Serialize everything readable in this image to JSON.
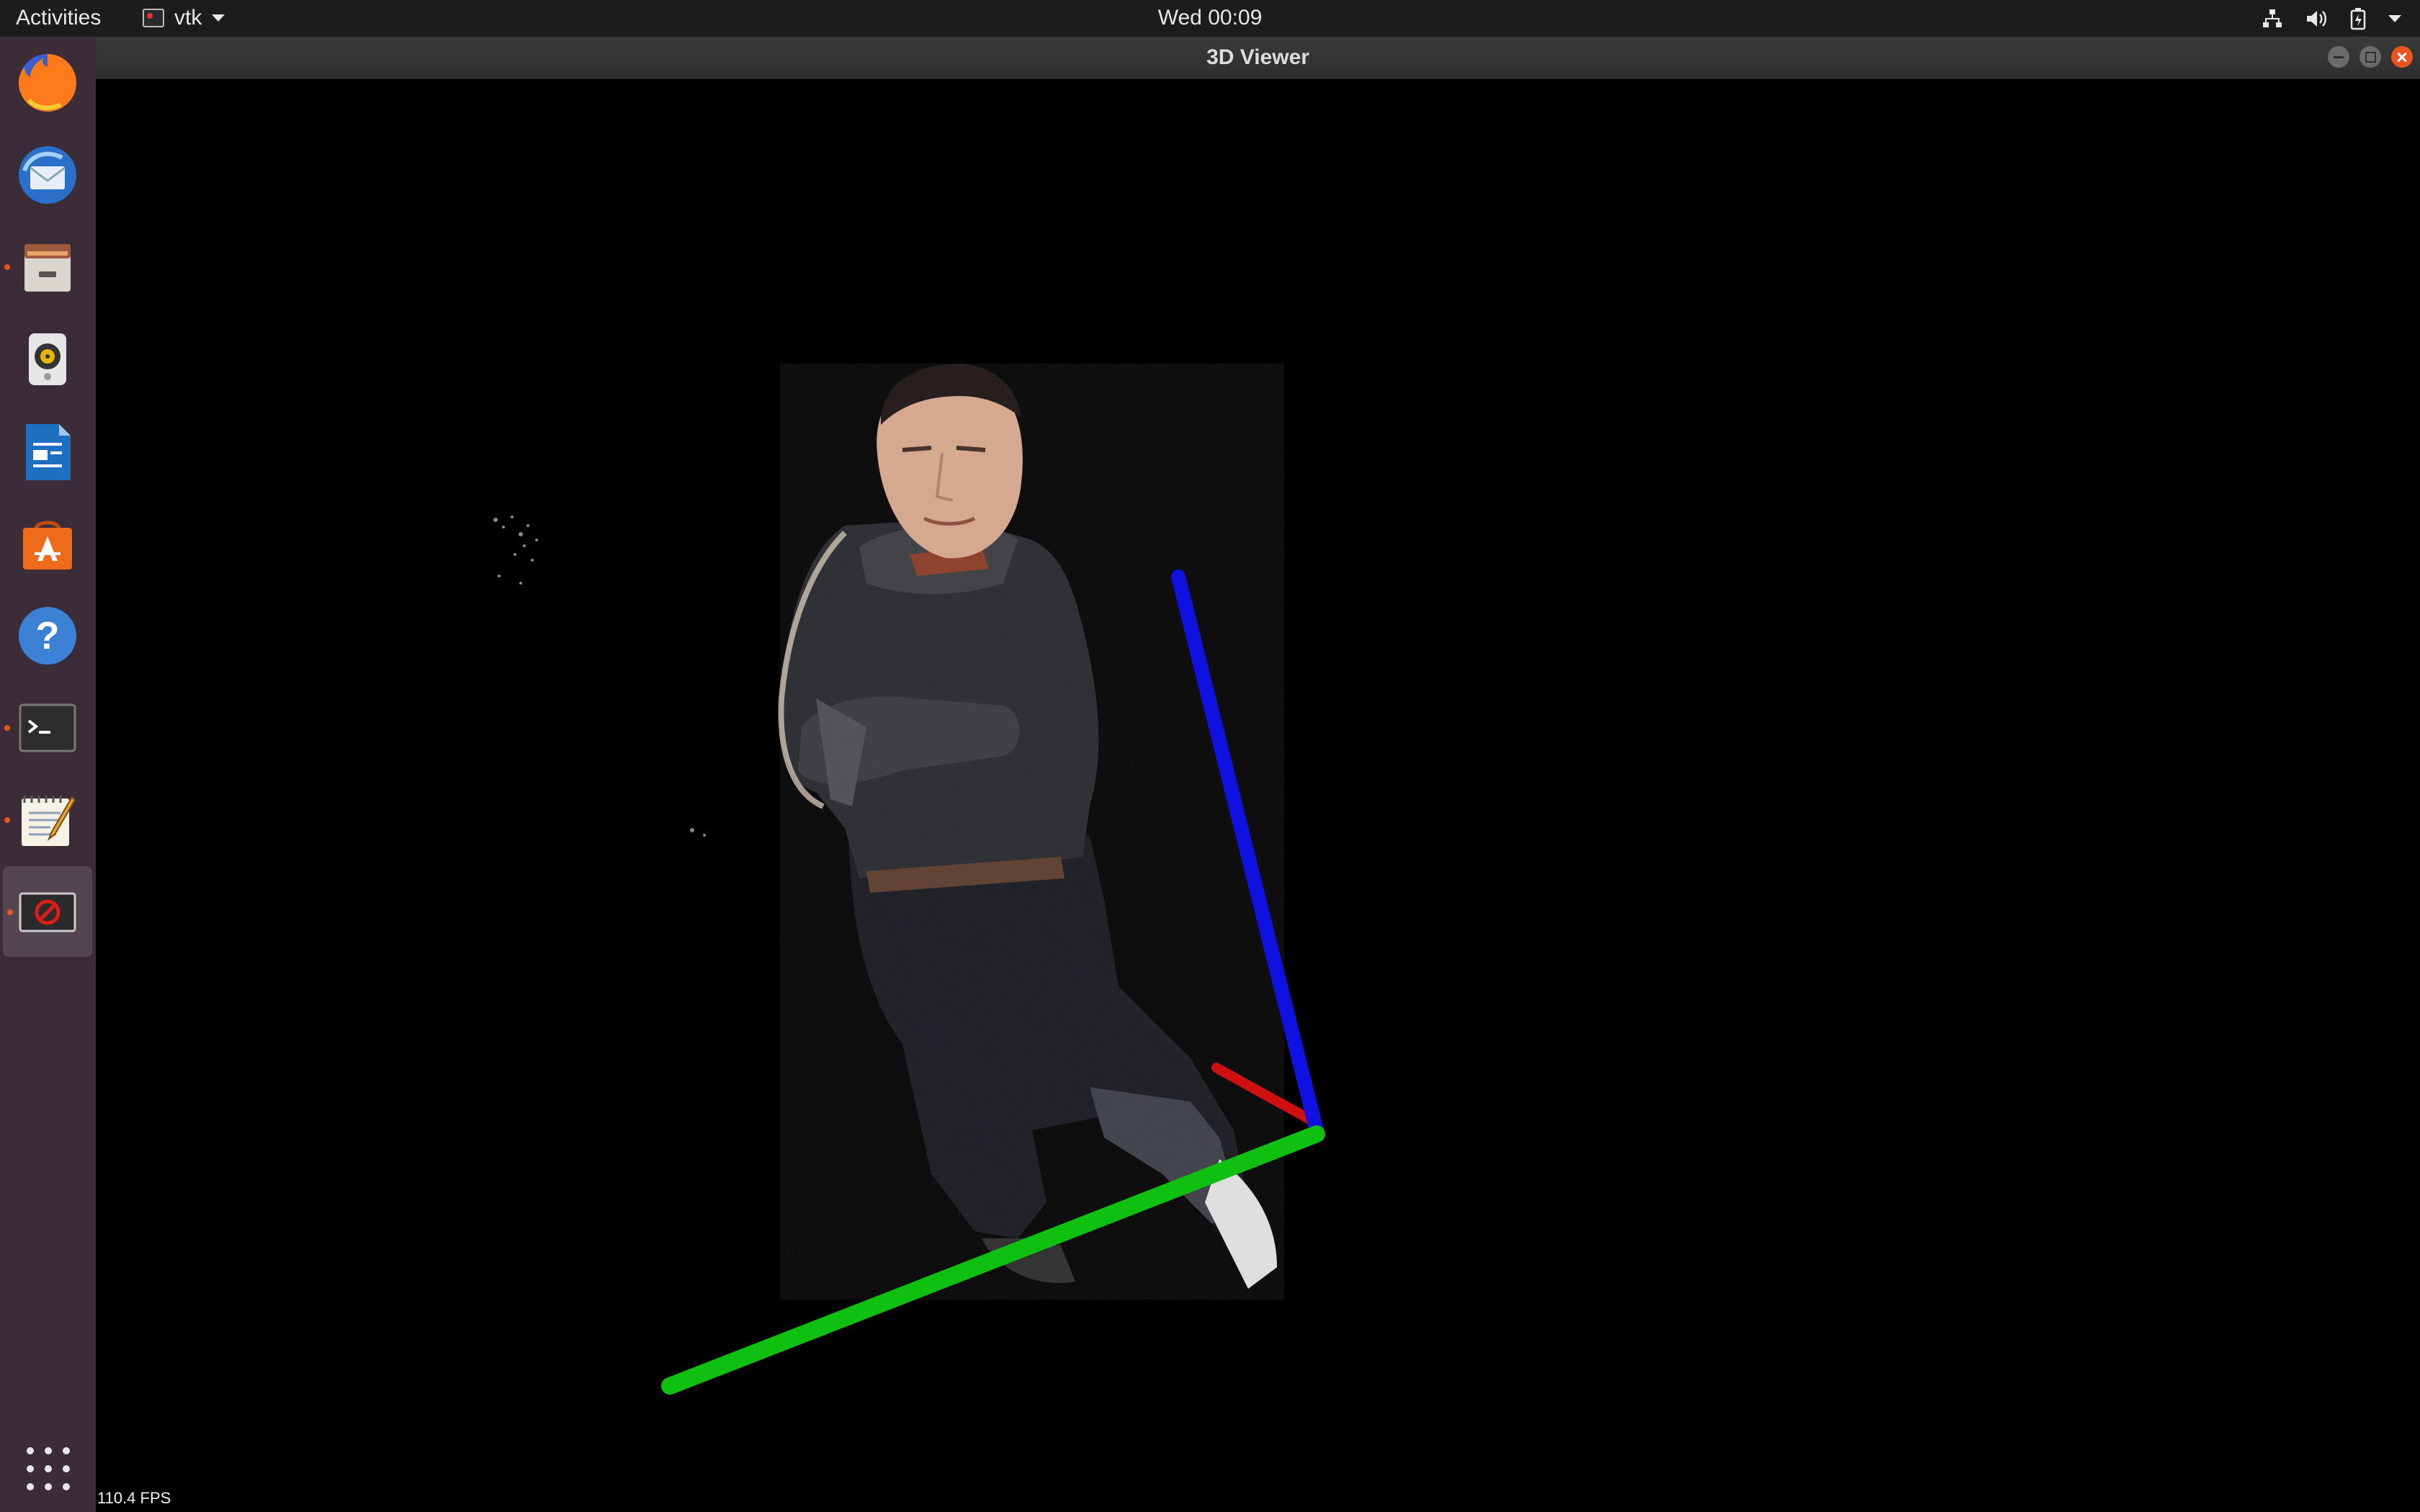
{
  "topbar": {
    "activities": "Activities",
    "app_name": "vtk",
    "clock": "Wed 00:09",
    "system_icons": [
      "network-icon",
      "volume-icon",
      "battery-icon",
      "system-menu-caret-icon"
    ]
  },
  "dock": {
    "items": [
      {
        "name": "Firefox",
        "icon": "firefox-icon",
        "running": false
      },
      {
        "name": "Thunderbird",
        "icon": "thunderbird-icon",
        "running": false
      },
      {
        "name": "Files",
        "icon": "files-icon",
        "running": true
      },
      {
        "name": "Rhythmbox",
        "icon": "rhythmbox-icon",
        "running": false
      },
      {
        "name": "LibreOffice Writer",
        "icon": "writer-icon",
        "running": false
      },
      {
        "name": "Ubuntu Software",
        "icon": "software-icon",
        "running": false
      },
      {
        "name": "Help",
        "icon": "help-icon",
        "running": false
      },
      {
        "name": "Terminal",
        "icon": "terminal-icon",
        "running": true
      },
      {
        "name": "Text Editor",
        "icon": "text-editor-icon",
        "running": true
      },
      {
        "name": "vtk",
        "icon": "vtk-app-icon",
        "running": true,
        "active": true
      }
    ],
    "show_apps_icon": "grid-icon"
  },
  "window": {
    "title": "3D Viewer",
    "buttons": [
      "minimize",
      "maximize",
      "close"
    ]
  },
  "viewer": {
    "fps": "110.4 FPS",
    "axes_colors": {
      "x": "#d01010",
      "y": "#10c010",
      "z": "#1010e0"
    },
    "background": "#000000"
  },
  "colors": {
    "topbar": "#1c1c1c",
    "dock": "#3c2c38",
    "accent": "#e95420"
  }
}
